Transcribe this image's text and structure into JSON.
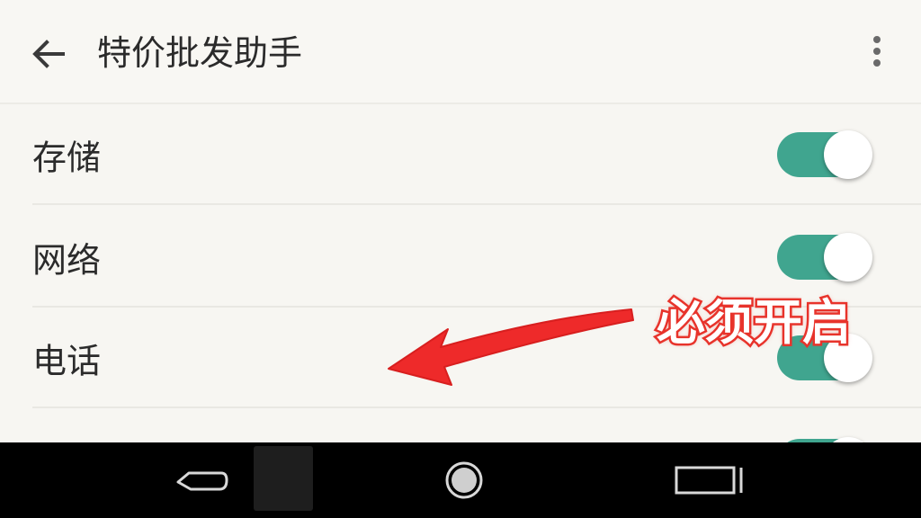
{
  "app_bar": {
    "title": "特价批发助手",
    "back_icon": "arrow-left-icon",
    "more_icon": "more-vertical-icon"
  },
  "permissions": [
    {
      "label": "存储",
      "enabled": true
    },
    {
      "label": "网络",
      "enabled": true
    },
    {
      "label": "电话",
      "enabled": true
    },
    {
      "label": "",
      "enabled": true
    }
  ],
  "annotation": {
    "text": "必须开启",
    "color": "#e8342c"
  },
  "nav_bar": {
    "back_icon": "nav-back-icon",
    "home_icon": "nav-home-icon",
    "recent_icon": "nav-recent-icon"
  },
  "colors": {
    "toggle_on": "#40a58f",
    "background": "#f7f6f2",
    "nav_background": "#000000"
  }
}
